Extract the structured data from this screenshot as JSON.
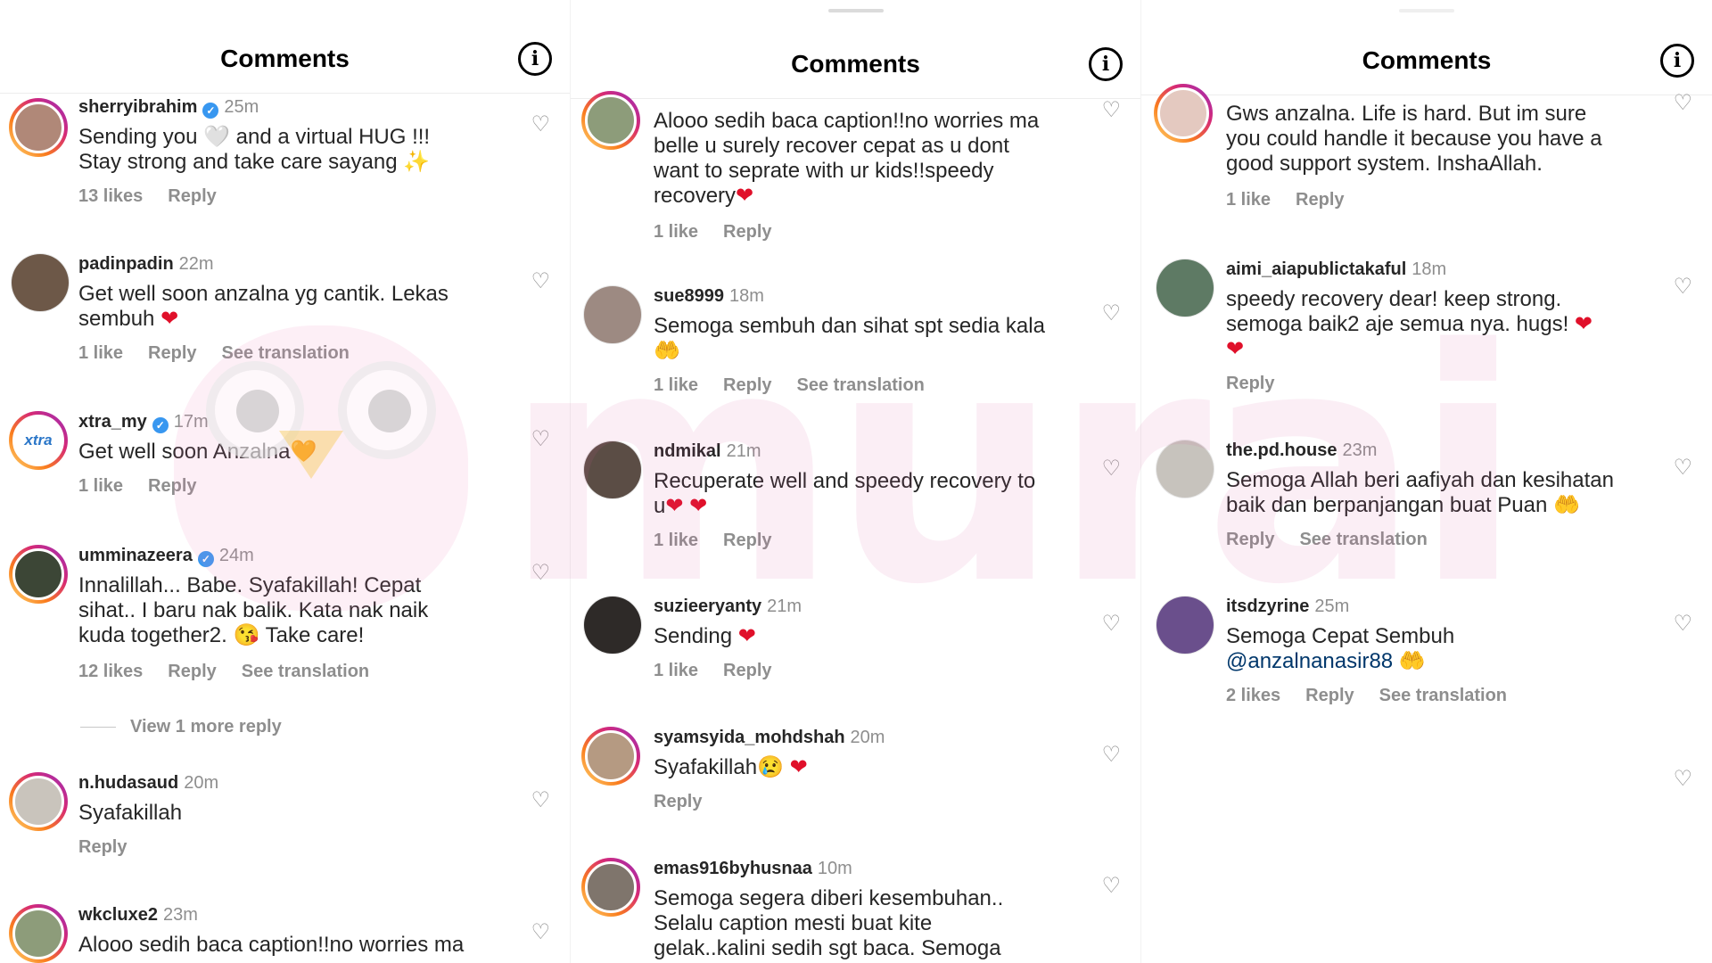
{
  "app": {
    "watermark": "murai"
  },
  "colors": {
    "accent": "#3897f0",
    "heart": "#e0102a",
    "muted": "#8e8e8e",
    "mention": "#00376b"
  },
  "panels": [
    {
      "title": "Comments",
      "comments": [
        {
          "user": "sherryibrahim",
          "time": "25m",
          "verified": true,
          "text1": "Sending you ",
          "emoji1": "🤍",
          "text2": " and a virtual HUG !!!",
          "text3": "Stay strong and take care sayang ",
          "emoji2": "✨",
          "likes": "13 likes",
          "reply": "Reply"
        },
        {
          "user": "padinpadin",
          "time": "22m",
          "line1": "Get well soon anzalna yg cantik. Lekas",
          "line2": "sembuh ",
          "emoji": "❤",
          "likes": "1 like",
          "reply": "Reply",
          "translate": "See translation"
        },
        {
          "user": "xtra_my",
          "time": "17m",
          "verified": true,
          "avatar_text": "xtra",
          "line1": "Get well soon Anzalna",
          "emoji": "🧡",
          "likes": "1 like",
          "reply": "Reply"
        },
        {
          "user": "umminazeera",
          "time": "24m",
          "verified": true,
          "line1": "Innalillah... Babe. Syafakillah! Cepat",
          "line2": "sihat.. I baru nak balik. Kata nak naik",
          "line3": "kuda together2. ",
          "emoji": "😘",
          "line3b": " Take care!",
          "likes": "12 likes",
          "reply": "Reply",
          "translate": "See translation"
        },
        {
          "view_more": "View 1 more reply"
        },
        {
          "user": "n.hudasaud",
          "time": "20m",
          "line1": "Syafakillah",
          "reply": "Reply"
        },
        {
          "user": "wkcluxe2",
          "time": "23m",
          "line1": "Alooo sedih baca caption!!no worries ma"
        }
      ]
    },
    {
      "title": "Comments",
      "comments": [
        {
          "line1": "Alooo sedih baca caption!!no worries ma",
          "line2": "belle u surely recover cepat as u dont",
          "line3": "want to seprate with ur kids!!speedy",
          "line4": "recovery",
          "emoji": "❤",
          "likes": "1 like",
          "reply": "Reply"
        },
        {
          "user": "sue8999",
          "time": "18m",
          "line1": "Semoga sembuh dan sihat spt sedia kala",
          "emoji": "🤲",
          "likes": "1 like",
          "reply": "Reply",
          "translate": "See translation"
        },
        {
          "user": "ndmikal",
          "time": "21m",
          "line1": "Recuperate well and speedy recovery to",
          "line2": "u",
          "emoji": "❤ ❤",
          "likes": "1 like",
          "reply": "Reply"
        },
        {
          "user": "suzieeryanty",
          "time": "21m",
          "line1": "Sending ",
          "emoji": "❤",
          "likes": "1 like",
          "reply": "Reply"
        },
        {
          "user": "syamsyida_mohdshah",
          "time": "20m",
          "line1": "Syafakillah",
          "emoji1": "😢",
          "emoji": "❤",
          "reply": "Reply"
        },
        {
          "user": "emas916byhusnaa",
          "time": "10m",
          "line1": "Semoga segera diberi kesembuhan..",
          "line2": "Selalu caption mesti buat kite",
          "line3": "gelak..kalini sedih sgt baca. Semoga"
        }
      ]
    },
    {
      "title": "Comments",
      "comments": [
        {
          "line1": "Gws anzalna. Life is hard. But im sure",
          "line2": "you could handle it because you have a",
          "line3": "good support system. InshaAllah.",
          "likes": "1 like",
          "reply": "Reply"
        },
        {
          "user": "aimi_aiapublictakaful",
          "time": "18m",
          "line1": "speedy recovery dear! keep strong.",
          "line2": "semoga baik2 aje semua nya. hugs! ",
          "emoji": "❤",
          "emoji2": "❤",
          "reply": "Reply"
        },
        {
          "user": "the.pd.house",
          "time": "23m",
          "line1": "Semoga Allah beri aafiyah dan kesihatan",
          "line2": "baik dan berpanjangan buat Puan ",
          "emoji": "🤲",
          "reply": "Reply",
          "translate": "See translation"
        },
        {
          "user": "itsdzyrine",
          "time": "25m",
          "line1": "Semoga Cepat Sembuh",
          "mention": "@anzalnanasir88",
          "emoji": "🤲",
          "likes": "2 likes",
          "reply": "Reply",
          "translate": "See translation"
        }
      ]
    }
  ],
  "icons": {
    "info": "info-icon",
    "like": "heart-outline-icon",
    "verified": "verified-badge-icon"
  }
}
